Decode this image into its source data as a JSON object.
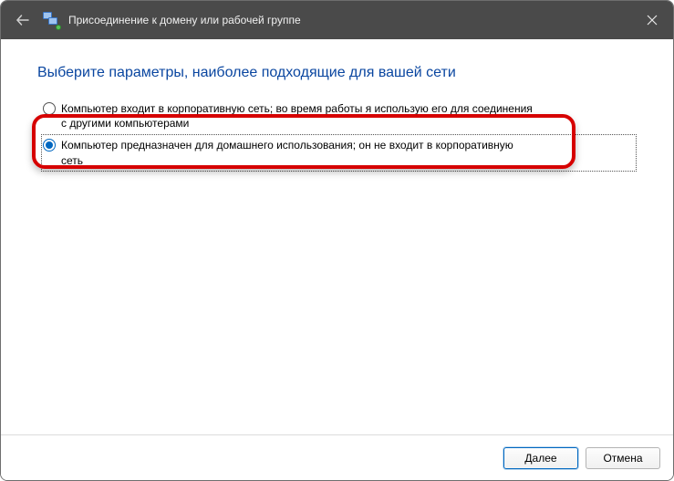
{
  "titlebar": {
    "title": "Присоединение к домену или рабочей группе"
  },
  "heading": "Выберите параметры, наиболее подходящие для вашей сети",
  "options": [
    {
      "label": "Компьютер входит в корпоративную сеть; во время работы я использую его для соединения с другими компьютерами",
      "checked": false
    },
    {
      "label": "Компьютер предназначен для домашнего использования; он не входит в корпоративную сеть",
      "checked": true
    }
  ],
  "footer": {
    "next": "Далее",
    "cancel": "Отмена"
  }
}
